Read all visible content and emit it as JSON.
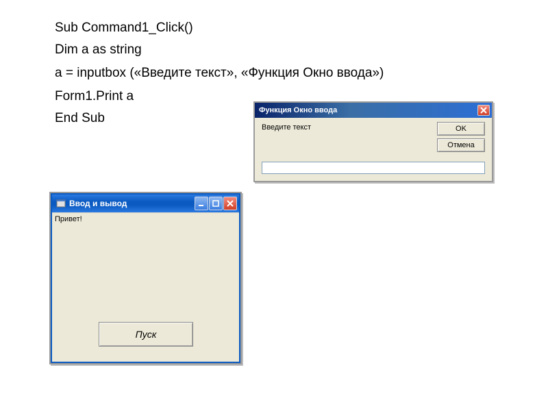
{
  "code": {
    "line1": "Sub Command1_Click()",
    "line2": "Dim a as string",
    "line3": "a = inputbox («Введите текст», «Функция Окно ввода»)",
    "line4": "Form1.Print a",
    "line5": "End Sub"
  },
  "inputbox": {
    "title": "Функция Окно ввода",
    "prompt": "Введите текст",
    "ok": "OK",
    "cancel": "Отмена",
    "value": ""
  },
  "form": {
    "title": "Ввод и вывод",
    "output": "Привет!",
    "run": "Пуск"
  }
}
